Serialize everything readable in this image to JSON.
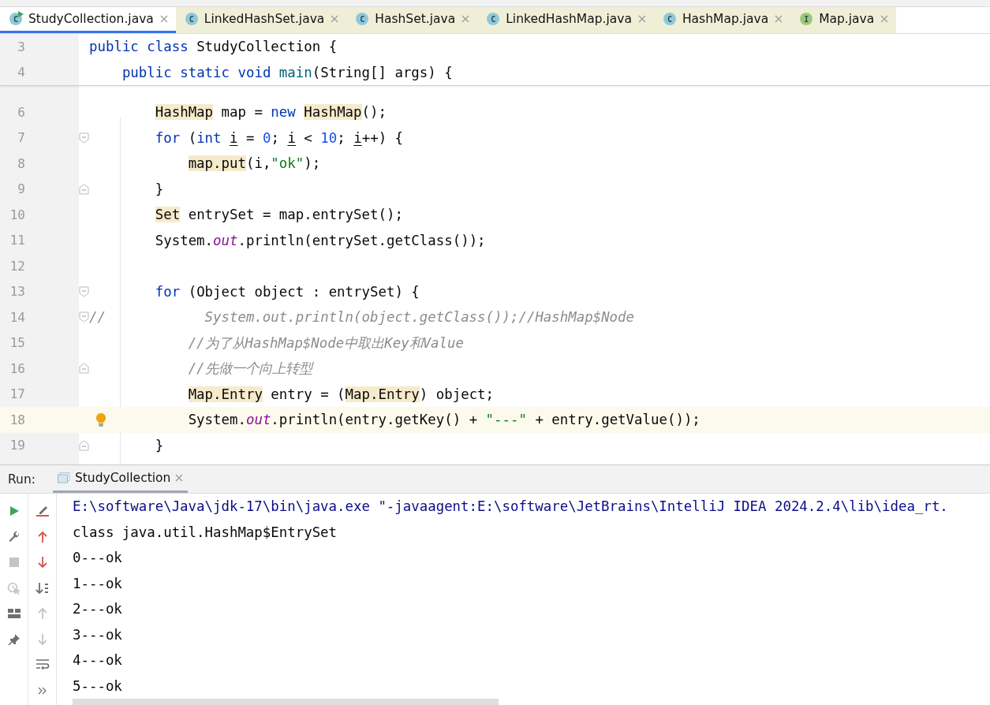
{
  "tabs": [
    {
      "label": "StudyCollection.java",
      "icon": "C",
      "kind": "class",
      "runnable": true,
      "selected": true
    },
    {
      "label": "LinkedHashSet.java",
      "icon": "C",
      "kind": "class",
      "runnable": false,
      "selected": false
    },
    {
      "label": "HashSet.java",
      "icon": "C",
      "kind": "class",
      "runnable": false,
      "selected": false
    },
    {
      "label": "LinkedHashMap.java",
      "icon": "C",
      "kind": "class",
      "runnable": false,
      "selected": false
    },
    {
      "label": "HashMap.java",
      "icon": "C",
      "kind": "class",
      "runnable": false,
      "selected": false
    },
    {
      "label": "Map.java",
      "icon": "I",
      "kind": "interface",
      "runnable": false,
      "selected": false
    }
  ],
  "sticky_lines": [
    {
      "number": "3",
      "tokens": [
        {
          "t": "public",
          "kind": "keyword"
        },
        {
          "t": " class",
          "kind": "keyword"
        },
        {
          "t": " StudyCollection {",
          "kind": "plain"
        }
      ]
    },
    {
      "number": "4",
      "tokens": [
        {
          "t": "    public",
          "kind": "keyword"
        },
        {
          "t": " static",
          "kind": "keyword"
        },
        {
          "t": " void",
          "kind": "keyword"
        },
        {
          "t": " main",
          "kind": "method"
        },
        {
          "t": "(String[] args) {",
          "kind": "plain"
        }
      ]
    }
  ],
  "lines": [
    {
      "number": "6",
      "fold_start": false,
      "fold_end": false,
      "current": false,
      "bulb": false,
      "tokens": [
        {
          "t": "        HashMap",
          "kind": "usage"
        },
        {
          "t": " map = ",
          "kind": "plain"
        },
        {
          "t": "new",
          "kind": "keyword"
        },
        {
          "t": " HashMap",
          "kind": "usage"
        },
        {
          "t": "();",
          "kind": "plain"
        }
      ]
    },
    {
      "number": "7",
      "fold_start": true,
      "fold_end": false,
      "current": false,
      "bulb": false,
      "tokens": [
        {
          "t": "        for",
          "kind": "keyword"
        },
        {
          "t": " (",
          "kind": "plain"
        },
        {
          "t": "int",
          "kind": "keyword"
        },
        {
          "t": " i",
          "kind": "variable"
        },
        {
          "t": " = ",
          "kind": "plain"
        },
        {
          "t": "0",
          "kind": "number"
        },
        {
          "t": "; ",
          "kind": "plain"
        },
        {
          "t": "i",
          "kind": "variable"
        },
        {
          "t": " < ",
          "kind": "plain"
        },
        {
          "t": "10",
          "kind": "number"
        },
        {
          "t": "; ",
          "kind": "plain"
        },
        {
          "t": "i",
          "kind": "variable"
        },
        {
          "t": "++) {",
          "kind": "plain"
        }
      ]
    },
    {
      "number": "8",
      "fold_start": false,
      "fold_end": false,
      "current": false,
      "bulb": false,
      "tokens": [
        {
          "t": "            map.put",
          "kind": "usage"
        },
        {
          "t": "(i,",
          "kind": "plain"
        },
        {
          "t": "\"ok\"",
          "kind": "string"
        },
        {
          "t": ");",
          "kind": "plain"
        }
      ]
    },
    {
      "number": "9",
      "fold_start": false,
      "fold_end": true,
      "current": false,
      "bulb": false,
      "tokens": [
        {
          "t": "        }",
          "kind": "plain"
        }
      ]
    },
    {
      "number": "10",
      "fold_start": false,
      "fold_end": false,
      "current": false,
      "bulb": false,
      "tokens": [
        {
          "t": "        Set",
          "kind": "usage"
        },
        {
          "t": " entrySet = map.entrySet();",
          "kind": "plain"
        }
      ]
    },
    {
      "number": "11",
      "fold_start": false,
      "fold_end": false,
      "current": false,
      "bulb": false,
      "tokens": [
        {
          "t": "        System.",
          "kind": "plain"
        },
        {
          "t": "out",
          "kind": "field"
        },
        {
          "t": ".println(entrySet.getClass());",
          "kind": "plain"
        }
      ]
    },
    {
      "number": "12",
      "fold_start": false,
      "fold_end": false,
      "current": false,
      "bulb": false
    },
    {
      "number": "13",
      "fold_start": true,
      "fold_end": false,
      "current": false,
      "bulb": false,
      "tokens": [
        {
          "t": "        for",
          "kind": "keyword"
        },
        {
          "t": " (Object object : entrySet) {",
          "kind": "plain"
        }
      ]
    },
    {
      "number": "14",
      "fold_start": true,
      "fold_end": false,
      "current": false,
      "bulb": false,
      "tokens": [
        {
          "t": "//            System.out.println(object.getClass());//HashMap$Node",
          "kind": "comment"
        }
      ]
    },
    {
      "number": "15",
      "fold_start": false,
      "fold_end": false,
      "current": false,
      "bulb": false,
      "tokens": [
        {
          "t": "            //为了从HashMap$Node中取出Key和Value",
          "kind": "comment"
        }
      ]
    },
    {
      "number": "16",
      "fold_start": false,
      "fold_end": true,
      "current": false,
      "bulb": false,
      "tokens": [
        {
          "t": "            //先做一个向上转型",
          "kind": "comment"
        }
      ]
    },
    {
      "number": "17",
      "fold_start": false,
      "fold_end": false,
      "current": false,
      "bulb": false,
      "tokens": [
        {
          "t": "            Map.Entry",
          "kind": "usage"
        },
        {
          "t": " entry = (",
          "kind": "plain"
        },
        {
          "t": "Map.Entry",
          "kind": "usage"
        },
        {
          "t": ") object;",
          "kind": "plain"
        }
      ]
    },
    {
      "number": "18",
      "fold_start": false,
      "fold_end": false,
      "current": true,
      "bulb": true,
      "tokens": [
        {
          "t": "            System.",
          "kind": "plain"
        },
        {
          "t": "out",
          "kind": "field"
        },
        {
          "t": ".println(entry.getKey() + ",
          "kind": "plain"
        },
        {
          "t": "\"---\"",
          "kind": "string"
        },
        {
          "t": " + entry.getValue());",
          "kind": "plain"
        }
      ]
    },
    {
      "number": "19",
      "fold_start": false,
      "fold_end": true,
      "current": false,
      "bulb": false,
      "tokens": [
        {
          "t": "        }",
          "kind": "plain"
        }
      ]
    }
  ],
  "run_panel": {
    "label": "Run:",
    "tab": {
      "label": "StudyCollection",
      "selected": true
    },
    "left_toolbar": [
      {
        "kind": "run",
        "disabled": false
      },
      {
        "kind": "wrench",
        "disabled": false
      },
      {
        "kind": "stop",
        "disabled": true
      },
      {
        "kind": "coverage",
        "disabled": true
      },
      {
        "kind": "layout",
        "disabled": false
      },
      {
        "kind": "pin",
        "disabled": false
      }
    ],
    "right_toolbar": [
      {
        "kind": "clear",
        "disabled": false
      },
      {
        "kind": "up",
        "disabled": false
      },
      {
        "kind": "down",
        "disabled": false
      },
      {
        "kind": "sort",
        "disabled": false
      },
      {
        "kind": "up",
        "disabled": true
      },
      {
        "kind": "down",
        "disabled": true
      },
      {
        "kind": "wrap",
        "disabled": false
      },
      {
        "kind": "more",
        "disabled": false
      }
    ],
    "console": [
      {
        "kind": "command",
        "text": "E:\\software\\Java\\jdk-17\\bin\\java.exe \"-javaagent:E:\\software\\JetBrains\\IntelliJ IDEA 2024.2.4\\lib\\idea_rt."
      },
      {
        "kind": "output",
        "text": "class java.util.HashMap$EntrySet"
      },
      {
        "kind": "output",
        "text": "0---ok"
      },
      {
        "kind": "output",
        "text": "1---ok"
      },
      {
        "kind": "output",
        "text": "2---ok"
      },
      {
        "kind": "output",
        "text": "3---ok"
      },
      {
        "kind": "output",
        "text": "4---ok"
      },
      {
        "kind": "output",
        "text": "5---ok"
      }
    ]
  }
}
